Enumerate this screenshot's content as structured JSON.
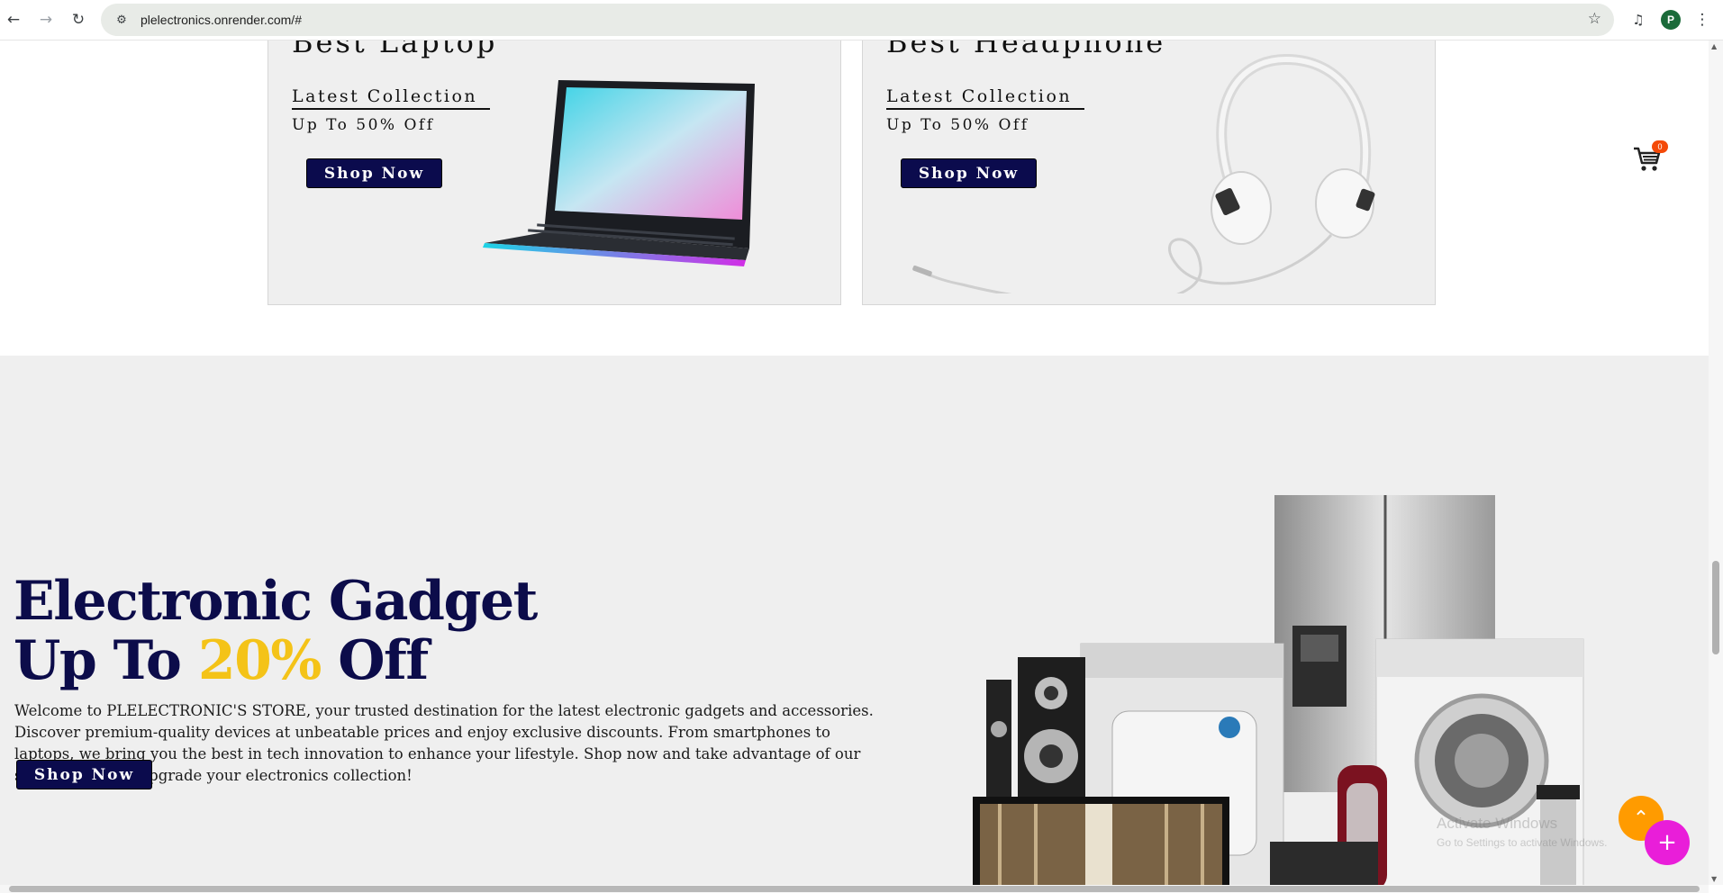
{
  "browser": {
    "url": "plelectronics.onrender.com/#",
    "profile_initial": "P"
  },
  "cards": [
    {
      "title": "Best Laptop",
      "subtitle": "Latest Collection",
      "offer": "Up To 50% Off",
      "button": "Shop Now",
      "image": "laptop-image"
    },
    {
      "title": "Best Headphone",
      "subtitle": "Latest Collection",
      "offer": "Up To 50% Off",
      "button": "Shop Now",
      "image": "headphone-image"
    }
  ],
  "cart": {
    "count": "0"
  },
  "hero": {
    "heading_line1": "Electronic Gadget",
    "heading_line2_prefix": "Up To ",
    "heading_line2_accent": "20%",
    "heading_line2_suffix": " Off",
    "description": "Welcome to PLELECTRONIC'S STORE, your trusted destination for the latest electronic gadgets and accessories. Discover premium-quality devices at unbeatable prices and enjoy exclusive discounts. From smartphones to laptops, we bring you the best in tech innovation to enhance your lifestyle. Shop now and take advantage of our special offers to upgrade your electronics collection!",
    "button": "Shop Now",
    "image": "appliances-image"
  },
  "watermark": {
    "line1": "Activate Windows",
    "line2": "Go to Settings to activate Windows."
  },
  "colors": {
    "navy": "#0b0b4d",
    "accent_yellow": "#f4c318",
    "fab_orange": "#ff9b00",
    "fab_magenta": "#e91ed9",
    "badge_orange": "#f44a09"
  }
}
